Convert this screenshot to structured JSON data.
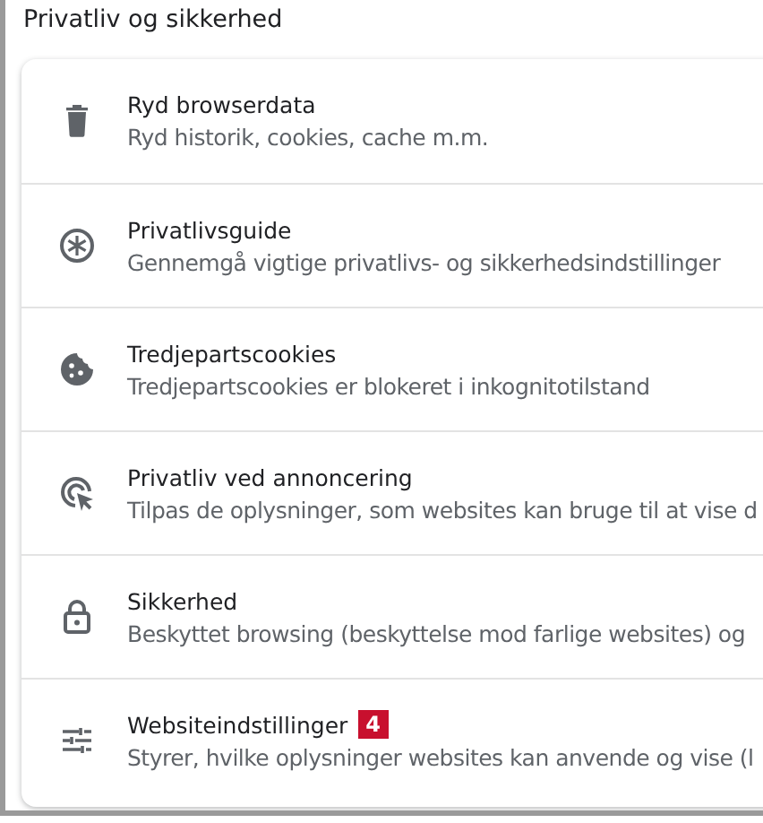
{
  "section_title": "Privatliv og sikkerhed",
  "items": [
    {
      "kind": "trash",
      "title": "Ryd browserdata",
      "subtitle": "Ryd historik, cookies, cache m.m."
    },
    {
      "kind": "guide",
      "title": "Privatlivsguide",
      "subtitle": "Gennemgå vigtige privatlivs- og sikkerhedsindstillinger"
    },
    {
      "kind": "cookie",
      "title": "Tredjepartscookies",
      "subtitle": "Tredjepartscookies er blokeret i inkognitotilstand"
    },
    {
      "kind": "ads",
      "title": "Privatliv ved annoncering",
      "subtitle": "Tilpas de oplysninger, som websites kan bruge til at vise d"
    },
    {
      "kind": "lock",
      "title": "Sikkerhed",
      "subtitle": "Beskyttet browsing (beskyttelse mod farlige websites) og"
    },
    {
      "kind": "tune",
      "title": "Websiteindstillinger",
      "badge": "4",
      "subtitle": "Styrer, hvilke oplysninger websites kan anvende og vise (l"
    }
  ]
}
